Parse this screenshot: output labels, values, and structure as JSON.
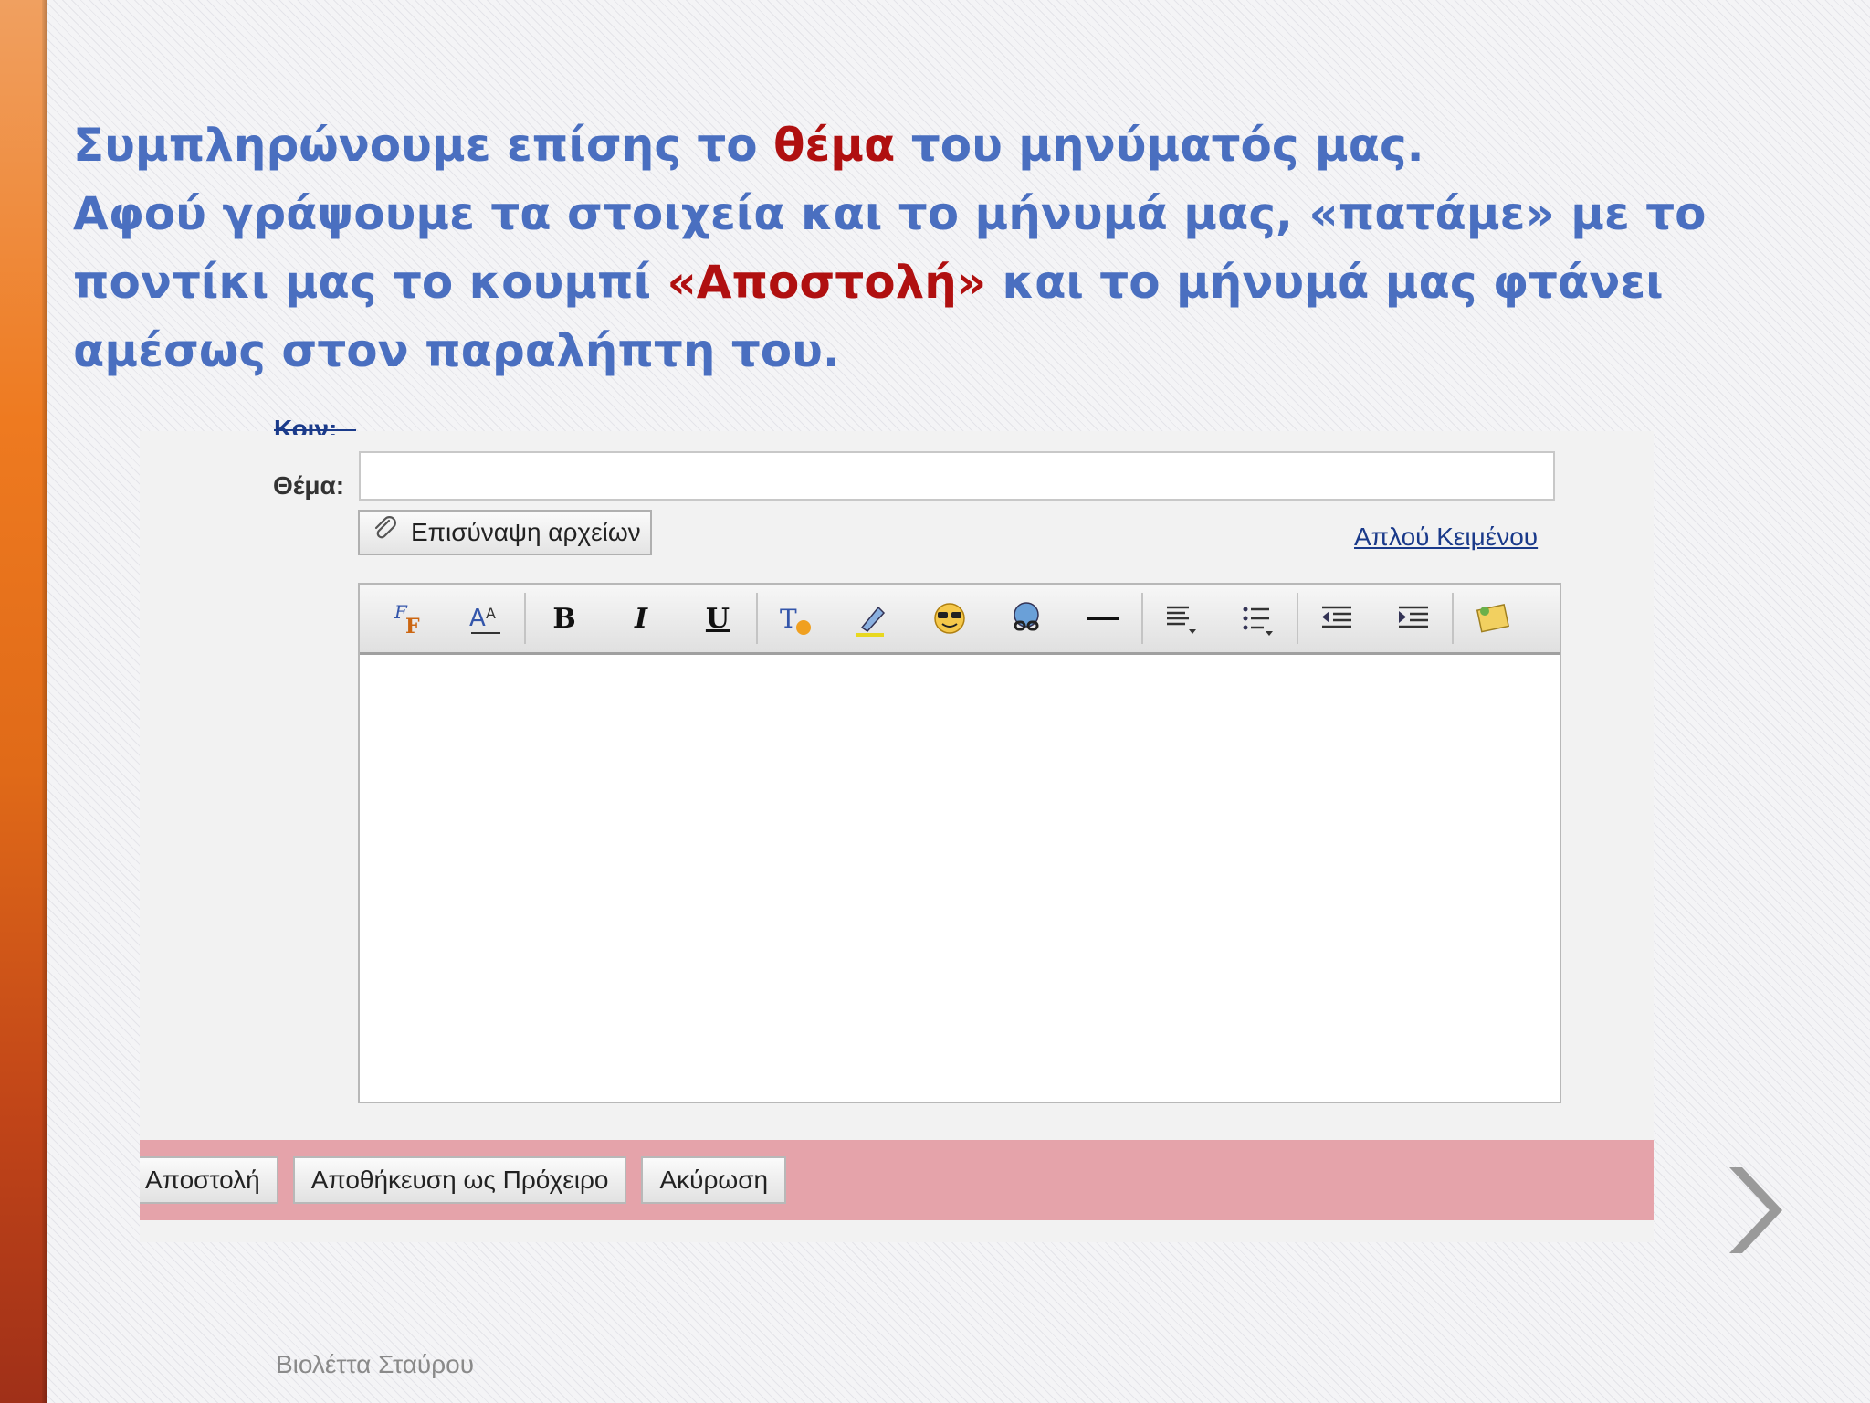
{
  "slide": {
    "heading": {
      "line1_pre": "Συμπληρώνουμε επίσης το ",
      "line1_hl": "θέμα",
      "line1_post": " του μηνύματός μας.",
      "line2": "Αφού γράψουμε τα στοιχεία και το μήνυμά μας, «πατάμε» με το ποντίκι μας το κουμπί ",
      "line2_hl": "«Αποστολή»",
      "line2_post": " και το μήνυμά μας φτάνει αμέσως στον παραλήπτη του."
    },
    "footer": "Βιολέττα Σταύρου"
  },
  "compose": {
    "cut_label": "Κοιν:",
    "subject_label": "Θέμα:",
    "subject_value": "",
    "attach_label": "Επισύναψη αρχείων",
    "plain_text_link": "Απλού Κειμένου",
    "toolbar": [
      "font-icon",
      "font-size-icon",
      "bold",
      "italic",
      "underline",
      "text-color-icon",
      "highlight-icon",
      "emoticon-icon",
      "link-icon",
      "horizontal-rule-icon",
      "align-icon",
      "list-icon",
      "outdent-icon",
      "indent-icon",
      "stationery-icon"
    ],
    "toolbar_text": {
      "bold": "B",
      "italic": "I",
      "underline": "U"
    },
    "actions": {
      "send": "Αποστολή",
      "save_draft": "Αποθήκευση ως Πρόχειρο",
      "cancel": "Ακύρωση"
    }
  },
  "colors": {
    "heading_blue": "#4a6fc0",
    "highlight_red": "#b01010",
    "action_bar": "#e5a3aa",
    "side_bar": "#ee7a20"
  }
}
